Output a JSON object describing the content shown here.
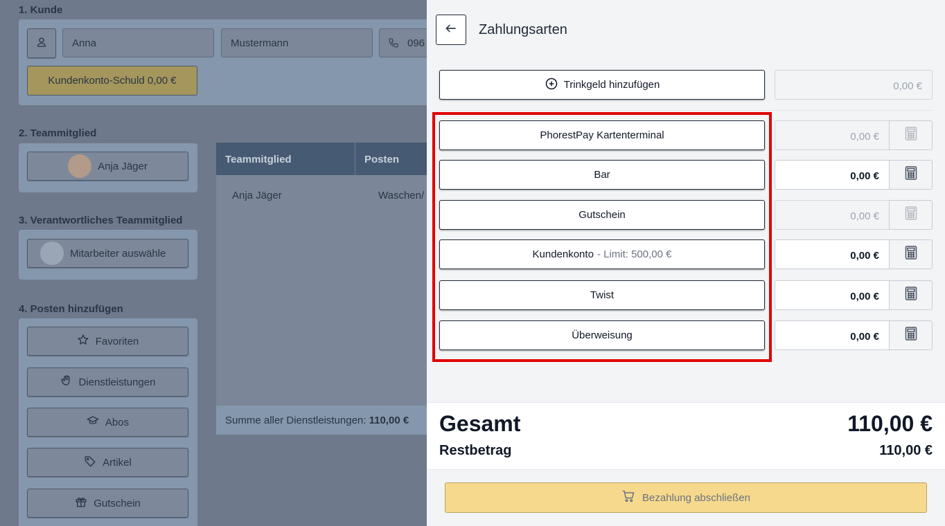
{
  "background": {
    "sections": {
      "customer": "1. Kunde",
      "team_member": "2. Teammitglied",
      "responsible": "3. Verantwortliches Teammitglied",
      "add_items": "4. Posten hinzufügen"
    },
    "customer": {
      "first_name": "Anna",
      "last_name": "Mustermann",
      "phone": "096",
      "debt_button": "Kundenkonto-Schuld 0,00 €"
    },
    "team_member_button": "Anja Jäger",
    "responsible_button": "Mitarbeiter auswähle",
    "add_buttons": {
      "favorites": "Favoriten",
      "services": "Dienstleistungen",
      "subscriptions": "Abos",
      "articles": "Artikel",
      "voucher": "Gutschein"
    },
    "table": {
      "headers": [
        "Teammitglied",
        "Posten"
      ],
      "row": [
        "Anja Jäger",
        "Waschen/"
      ],
      "footer_label": "Summe aller Dienstleistungen:",
      "footer_value": "110,00 €"
    }
  },
  "drawer": {
    "title": "Zahlungsarten",
    "tip_button": "Trinkgeld hinzufügen",
    "tip_amount": "0,00 €",
    "payment_methods": [
      {
        "label": "PhorestPay Kartenterminal",
        "amount": "0,00 €",
        "disabled": true
      },
      {
        "label": "Bar",
        "amount": "0,00 €",
        "disabled": false
      },
      {
        "label": "Gutschein",
        "amount": "0,00 €",
        "disabled": true
      },
      {
        "label": "Kundenkonto",
        "limit": "- Limit: 500,00 €",
        "amount": "0,00 €",
        "disabled": false
      },
      {
        "label": "Twist",
        "amount": "0,00 €",
        "disabled": false
      },
      {
        "label": "Überweisung",
        "amount": "0,00 €",
        "disabled": false
      }
    ],
    "total_label": "Gesamt",
    "total_value": "110,00 €",
    "rest_label": "Restbetrag",
    "rest_value": "110,00 €",
    "finish_button": "Bezahlung abschließen"
  },
  "icons": [
    "user-icon",
    "phone-icon",
    "star-icon",
    "hand-icon",
    "graduation-cap-icon",
    "tag-icon",
    "gift-icon",
    "arrow-left-icon",
    "plus-circle-icon",
    "calculator-icon",
    "cart-icon"
  ],
  "colors": {
    "highlight": "#e00000",
    "finish_button": "#f6d98d",
    "table_header": "#475a73"
  }
}
